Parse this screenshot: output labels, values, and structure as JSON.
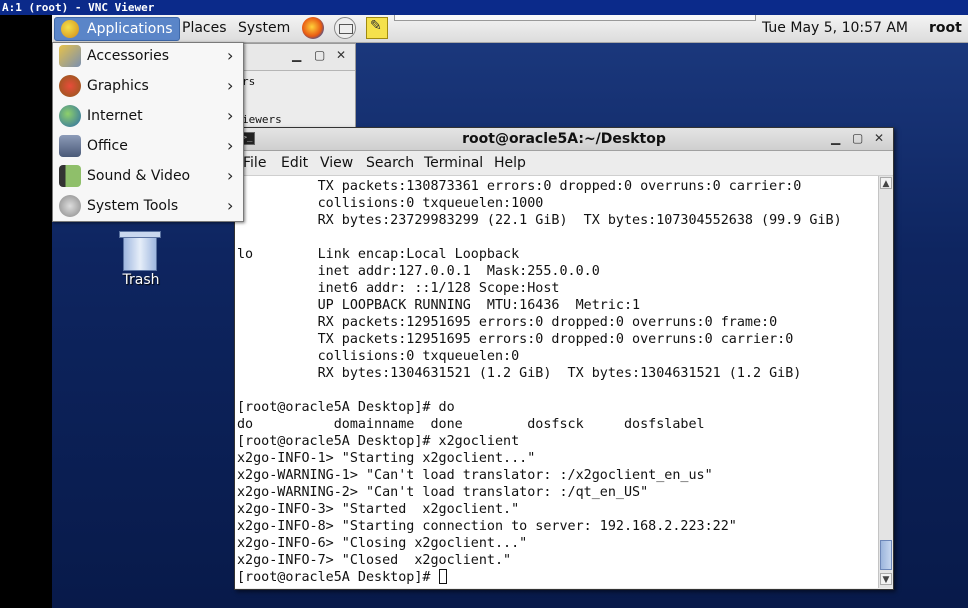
{
  "vnc": {
    "title": "A:1 (root) - VNC Viewer"
  },
  "panel": {
    "applications": "Applications",
    "places": "Places",
    "system": "System",
    "clock": "Tue May  5, 10:57 AM",
    "user": "root",
    "launchers": [
      "firefox-icon",
      "mail-icon",
      "notes-icon"
    ]
  },
  "app_menu": {
    "items": [
      {
        "label": "Accessories",
        "icon": "accessories-icon"
      },
      {
        "label": "Graphics",
        "icon": "graphics-icon"
      },
      {
        "label": "Internet",
        "icon": "internet-icon"
      },
      {
        "label": "Office",
        "icon": "office-icon"
      },
      {
        "label": "Sound & Video",
        "icon": "sound-video-icon"
      },
      {
        "label": "System Tools",
        "icon": "system-tools-icon"
      }
    ]
  },
  "back_window": {
    "line1": "rs",
    "line2": "iewers"
  },
  "desktop": {
    "trash_label": "Trash"
  },
  "terminal": {
    "title": "root@oracle5A:~/Desktop",
    "menu": [
      "File",
      "Edit",
      "View",
      "Search",
      "Terminal",
      "Help"
    ],
    "lines": [
      "          TX packets:130873361 errors:0 dropped:0 overruns:0 carrier:0",
      "          collisions:0 txqueuelen:1000",
      "          RX bytes:23729983299 (22.1 GiB)  TX bytes:107304552638 (99.9 GiB)",
      "",
      "lo        Link encap:Local Loopback",
      "          inet addr:127.0.0.1  Mask:255.0.0.0",
      "          inet6 addr: ::1/128 Scope:Host",
      "          UP LOOPBACK RUNNING  MTU:16436  Metric:1",
      "          RX packets:12951695 errors:0 dropped:0 overruns:0 frame:0",
      "          TX packets:12951695 errors:0 dropped:0 overruns:0 carrier:0",
      "          collisions:0 txqueuelen:0",
      "          RX bytes:1304631521 (1.2 GiB)  TX bytes:1304631521 (1.2 GiB)",
      "",
      "[root@oracle5A Desktop]# do",
      "do          domainname  done        dosfsck     dosfslabel",
      "[root@oracle5A Desktop]# x2goclient",
      "x2go-INFO-1> \"Starting x2goclient...\"",
      "x2go-WARNING-1> \"Can't load translator: :/x2goclient_en_us\"",
      "x2go-WARNING-2> \"Can't load translator: :/qt_en_US\"",
      "x2go-INFO-3> \"Started  x2goclient.\"",
      "x2go-INFO-8> \"Starting connection to server: 192.168.2.223:22\"",
      "x2go-INFO-6> \"Closing x2goclient...\"",
      "x2go-INFO-7> \"Closed  x2goclient.\""
    ],
    "prompt": "[root@oracle5A Desktop]# "
  }
}
